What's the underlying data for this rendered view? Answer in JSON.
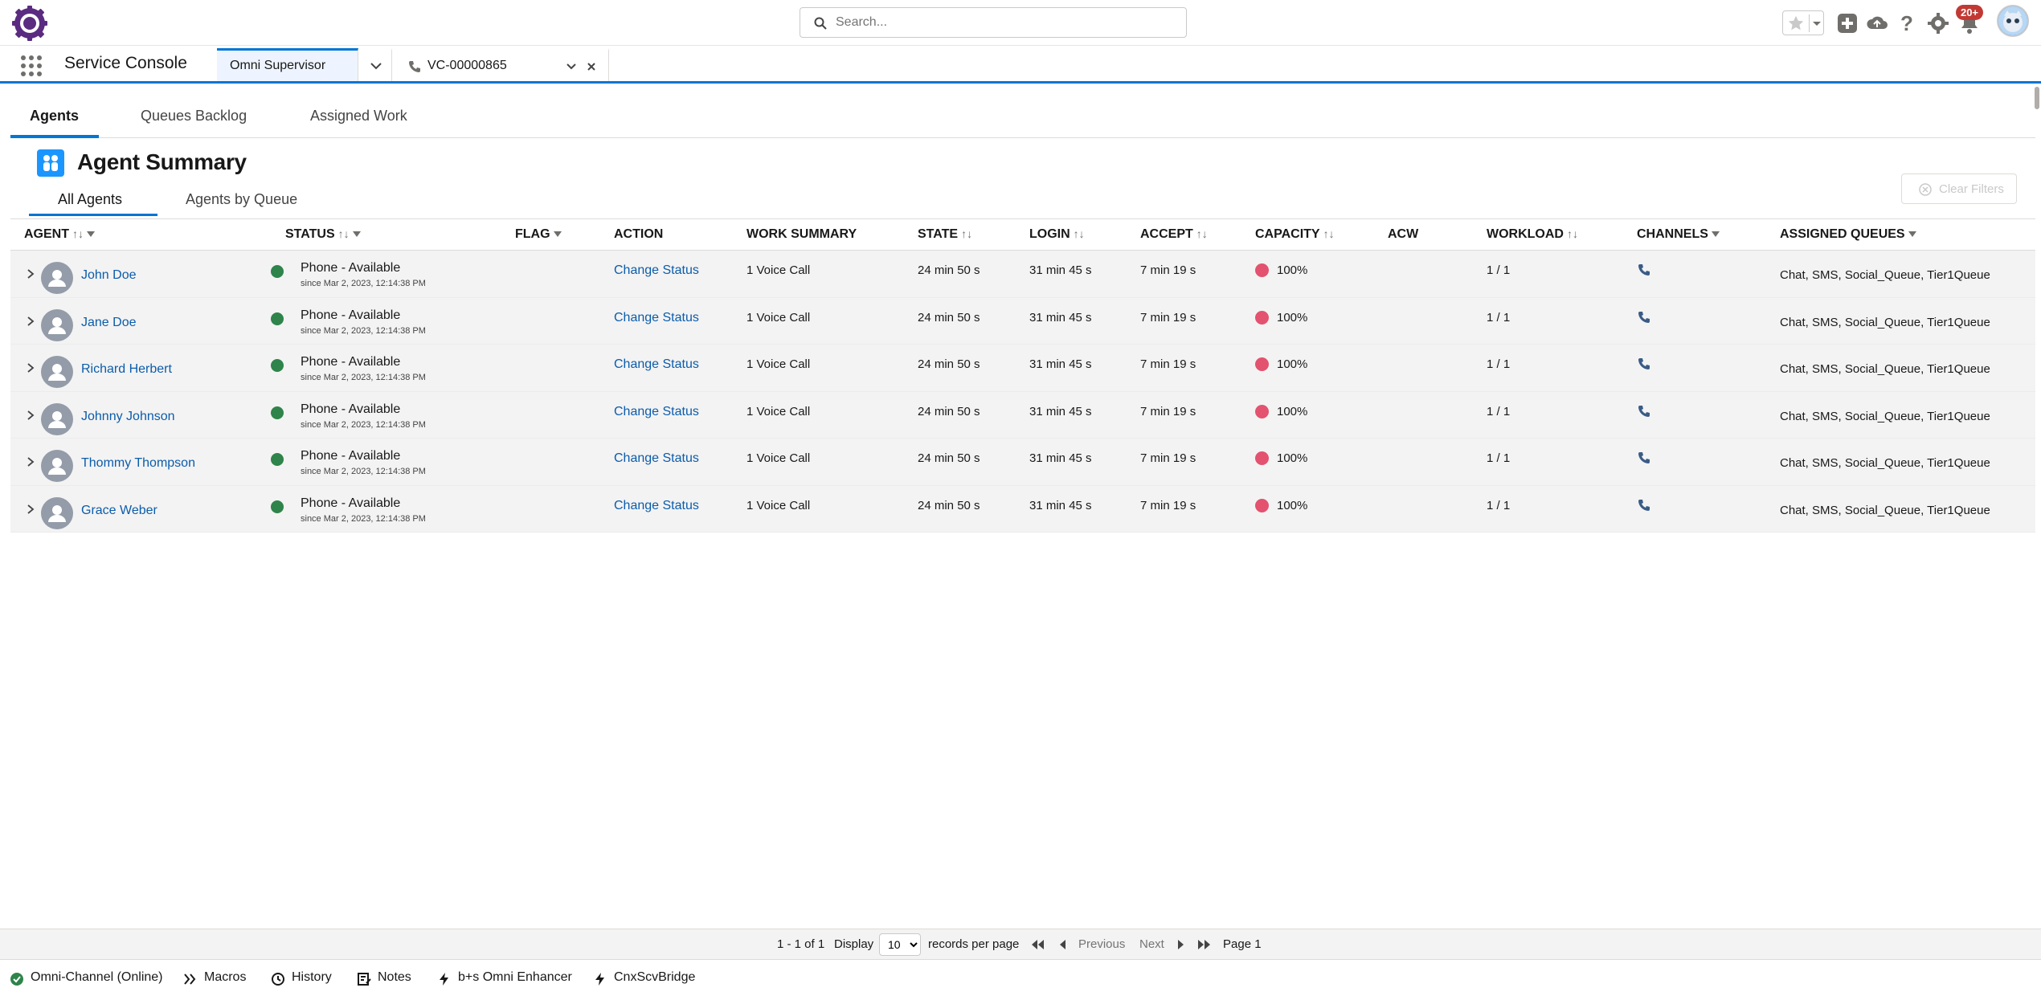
{
  "header": {
    "search_placeholder": "Search...",
    "notifications_badge": "20+"
  },
  "nav": {
    "app_name": "Service Console",
    "tabs": [
      {
        "label": "Omni Supervisor"
      },
      {
        "label": "VC-00000865"
      }
    ]
  },
  "subtabs": [
    "Agents",
    "Queues Backlog",
    "Assigned Work"
  ],
  "summary": {
    "title": "Agent Summary",
    "clear_filters_label": "Clear Filters",
    "view_tabs": [
      "All Agents",
      "Agents by Queue"
    ]
  },
  "table": {
    "columns": {
      "agent": "AGENT",
      "status": "STATUS",
      "flag": "FLAG",
      "action": "ACTION",
      "work_summary": "WORK SUMMARY",
      "state": "STATE",
      "login": "LOGIN",
      "accept": "ACCEPT",
      "capacity": "CAPACITY",
      "acw": "ACW",
      "workload": "WORKLOAD",
      "channels": "CHANNELS",
      "assigned_queues": "ASSIGNED QUEUES"
    },
    "rows": [
      {
        "agent": "John Doe",
        "status": "Phone - Available",
        "since": "since  Mar 2, 2023, 12:14:38 PM",
        "action": "Change Status",
        "work_summary": "1 Voice Call",
        "state": "24 min 50 s",
        "login": "31 min 45 s",
        "accept": "7 min 19 s",
        "capacity": "100%",
        "workload": "1 / 1",
        "queues": "Chat, SMS, Social_Queue, Tier1Queue"
      },
      {
        "agent": "Jane Doe",
        "status": "Phone - Available",
        "since": "since  Mar 2, 2023, 12:14:38 PM",
        "action": "Change Status",
        "work_summary": "1 Voice Call",
        "state": "24 min 50 s",
        "login": "31 min 45 s",
        "accept": "7 min 19 s",
        "capacity": "100%",
        "workload": "1 / 1",
        "queues": "Chat, SMS, Social_Queue, Tier1Queue"
      },
      {
        "agent": "Richard Herbert",
        "status": "Phone - Available",
        "since": "since  Mar 2, 2023, 12:14:38 PM",
        "action": "Change Status",
        "work_summary": "1 Voice Call",
        "state": "24 min 50 s",
        "login": "31 min 45 s",
        "accept": "7 min 19 s",
        "capacity": "100%",
        "workload": "1 / 1",
        "queues": "Chat, SMS, Social_Queue, Tier1Queue"
      },
      {
        "agent": "Johnny Johnson",
        "status": "Phone - Available",
        "since": "since  Mar 2, 2023, 12:14:38 PM",
        "action": "Change Status",
        "work_summary": "1 Voice Call",
        "state": "24 min 50 s",
        "login": "31 min 45 s",
        "accept": "7 min 19 s",
        "capacity": "100%",
        "workload": "1 / 1",
        "queues": "Chat, SMS, Social_Queue, Tier1Queue"
      },
      {
        "agent": "Thommy Thompson",
        "status": "Phone - Available",
        "since": "since  Mar 2, 2023, 12:14:38 PM",
        "action": "Change Status",
        "work_summary": "1 Voice Call",
        "state": "24 min 50 s",
        "login": "31 min 45 s",
        "accept": "7 min 19 s",
        "capacity": "100%",
        "workload": "1 / 1",
        "queues": "Chat, SMS, Social_Queue, Tier1Queue"
      },
      {
        "agent": "Grace Weber",
        "status": "Phone - Available",
        "since": "since  Mar 2, 2023, 12:14:38 PM",
        "action": "Change Status",
        "work_summary": "1 Voice Call",
        "state": "24 min 50 s",
        "login": "31 min 45 s",
        "accept": "7 min 19 s",
        "capacity": "100%",
        "workload": "1 / 1",
        "queues": "Chat, SMS, Social_Queue, Tier1Queue"
      }
    ]
  },
  "pager": {
    "range": "1 - 1 of 1",
    "display_label": "Display",
    "page_size": "10",
    "per_page_label": "records per page",
    "previous_label": "Previous",
    "next_label": "Next",
    "page_label": "Page 1"
  },
  "utility": {
    "items": [
      "Omni-Channel (Online)",
      "Macros",
      "History",
      "Notes",
      "b+s Omni Enhancer",
      "CnxScvBridge"
    ]
  },
  "colors": {
    "brand_blue": "#0176d3",
    "link_blue": "#0b5cab",
    "status_green": "#2e844a",
    "capacity_red": "#e3526f",
    "badge_red": "#c23934"
  }
}
